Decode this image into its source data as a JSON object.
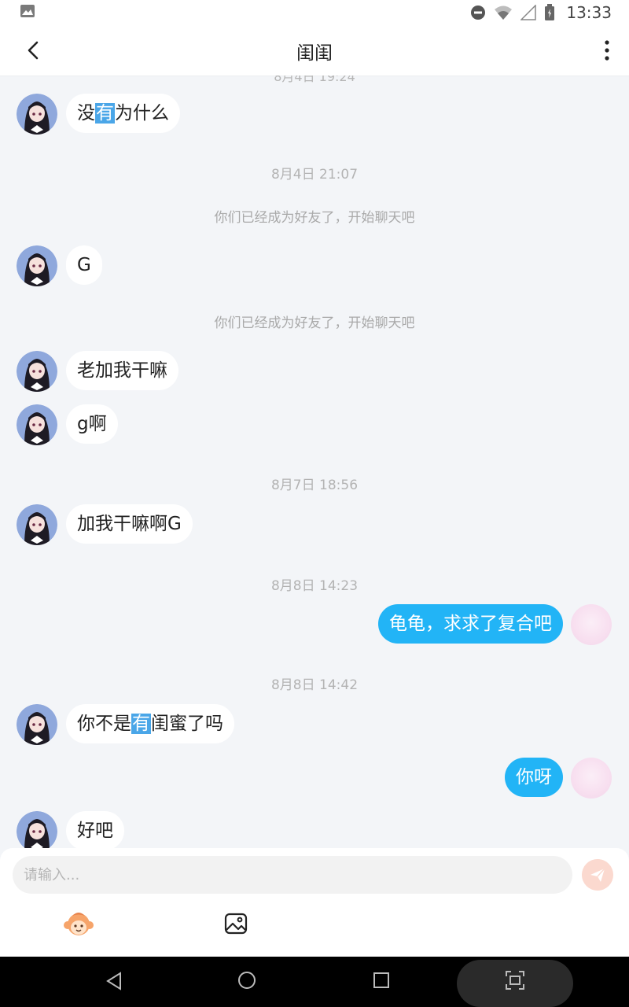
{
  "status_bar": {
    "time": "13:33"
  },
  "header": {
    "title": "闺闺"
  },
  "chat": {
    "partial_timestamp": "8月4日 19:24",
    "messages": {
      "m1": {
        "before": "没",
        "hl": "有",
        "after": "为什么"
      },
      "ts1": "8月4日 21:07",
      "sys1": "你们已经成为好友了，开始聊天吧",
      "m2": "G",
      "sys2": "你们已经成为好友了，开始聊天吧",
      "m3": "老加我干嘛",
      "m4": "g啊",
      "ts2": "8月7日 18:56",
      "m5": "加我干嘛啊G",
      "ts3": "8月8日 14:23",
      "m6": "龟龟，求求了复合吧",
      "ts4": "8月8日 14:42",
      "m7": {
        "before": "你不是",
        "hl": "有",
        "after": "闺蜜了吗"
      },
      "m8": "你呀",
      "m9": "好吧"
    }
  },
  "composer": {
    "placeholder": "请输入..."
  },
  "icons": {
    "back": "chevron-left-icon",
    "more": "more-vertical-icon",
    "send": "send-icon",
    "emoji": "monkey-emoji-icon",
    "image": "image-icon"
  }
}
